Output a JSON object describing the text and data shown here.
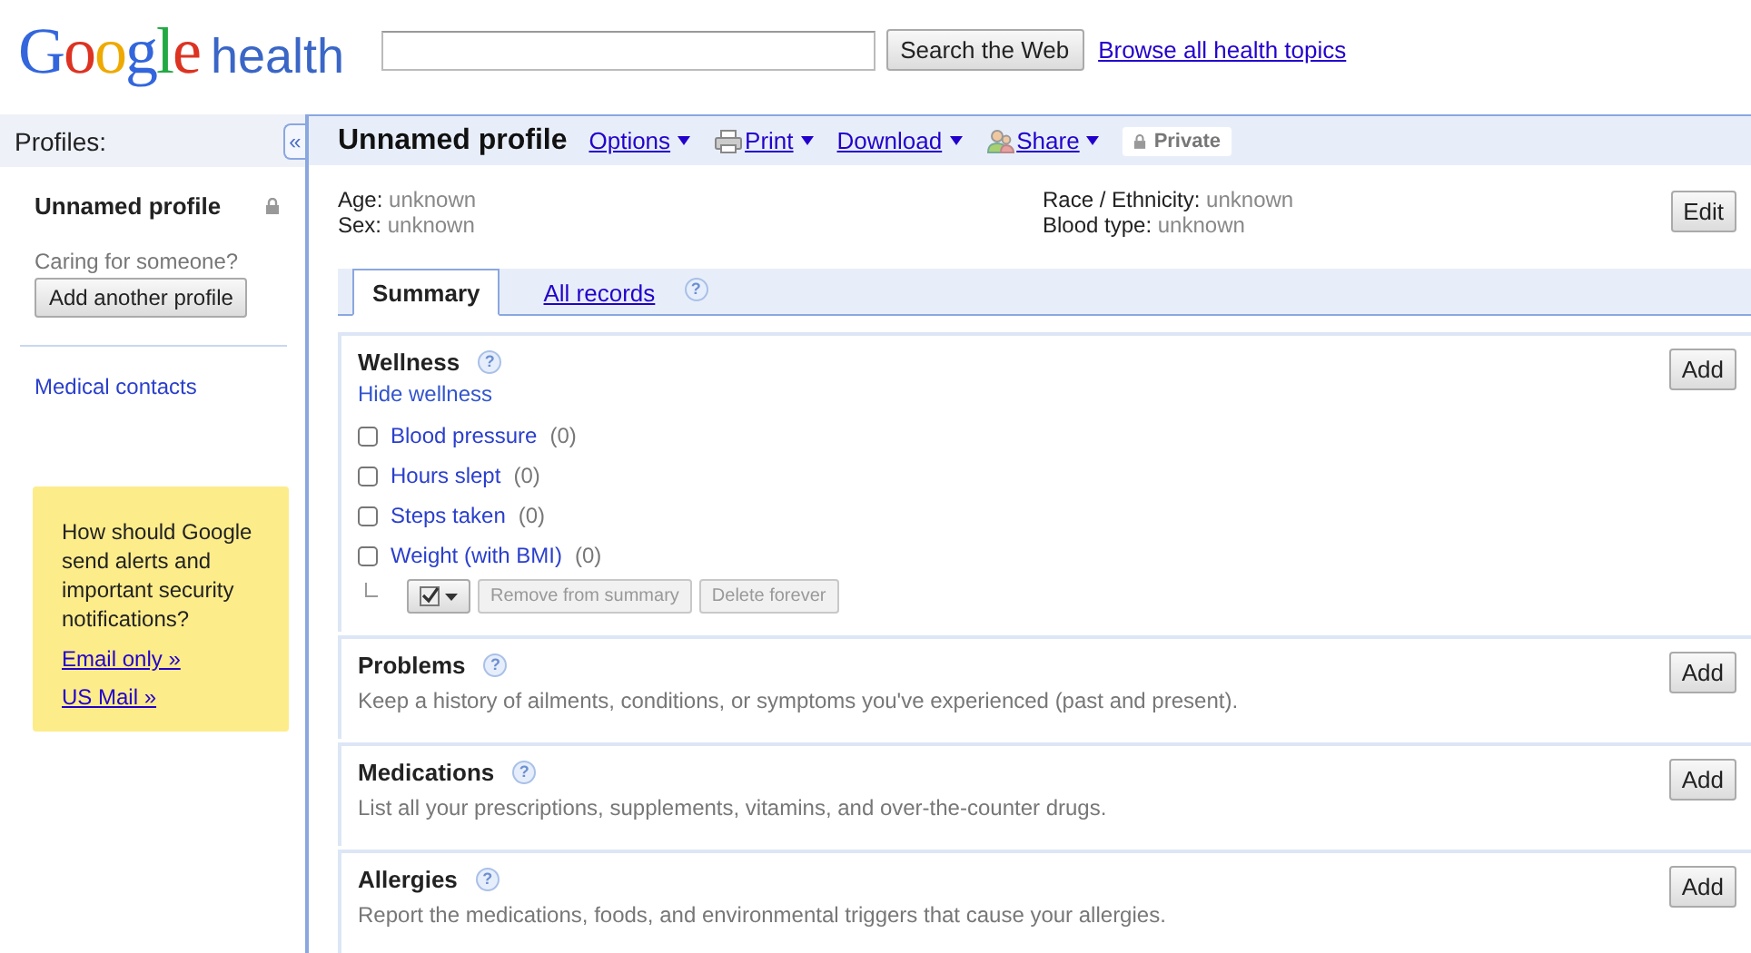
{
  "header": {
    "logo_brand": "Google",
    "logo_product": "health",
    "search_button": "Search the Web",
    "browse_link": "Browse all health topics"
  },
  "sidebar": {
    "title": "Profiles:",
    "collapse": "«",
    "profile": "Unnamed profile",
    "locked": true,
    "caring_prompt": "Caring for someone?",
    "add_profile_button": "Add another profile",
    "links": [
      "Medical contacts"
    ],
    "notice": {
      "text": "How should Google send alerts and important security notifications?",
      "links": [
        "Email only »",
        "US Mail »"
      ]
    }
  },
  "profile": {
    "title": "Unnamed profile",
    "menus": [
      {
        "label": "Options"
      },
      {
        "label": "Print"
      },
      {
        "label": "Download"
      },
      {
        "label": "Share"
      }
    ],
    "privacy": "Private",
    "fields_left": [
      {
        "label": "Age:",
        "value": "unknown"
      },
      {
        "label": "Sex:",
        "value": "unknown"
      }
    ],
    "fields_right": [
      {
        "label": "Race / Ethnicity:",
        "value": "unknown"
      },
      {
        "label": "Blood type:",
        "value": "unknown"
      }
    ],
    "edit_button": "Edit"
  },
  "tabs": [
    {
      "label": "Summary",
      "selected": true
    },
    {
      "label": "All records",
      "selected": false,
      "help": "?"
    }
  ],
  "sections": [
    {
      "title": "Wellness",
      "help": "?",
      "add_button": "Add",
      "hide_link": "Hide wellness",
      "items": [
        {
          "label": "Blood pressure",
          "count": "(0)",
          "checked": false
        },
        {
          "label": "Hours slept",
          "count": "(0)",
          "checked": false
        },
        {
          "label": "Steps taken",
          "count": "(0)",
          "checked": false
        },
        {
          "label": "Weight (with BMI)",
          "count": "(0)",
          "checked": false
        }
      ],
      "actions": [
        {
          "label": "Remove from summary",
          "disabled": true
        },
        {
          "label": "Delete forever",
          "disabled": true
        }
      ]
    },
    {
      "title": "Problems",
      "help": "?",
      "add_button": "Add",
      "description": "Keep a history of ailments, conditions, or symptoms you've experienced (past and present)."
    },
    {
      "title": "Medications",
      "help": "?",
      "add_button": "Add",
      "description": "List all your prescriptions, supplements, vitamins, and over-the-counter drugs."
    },
    {
      "title": "Allergies",
      "help": "?",
      "add_button": "Add",
      "description": "Report the medications, foods, and environmental triggers that cause your allergies."
    }
  ]
}
